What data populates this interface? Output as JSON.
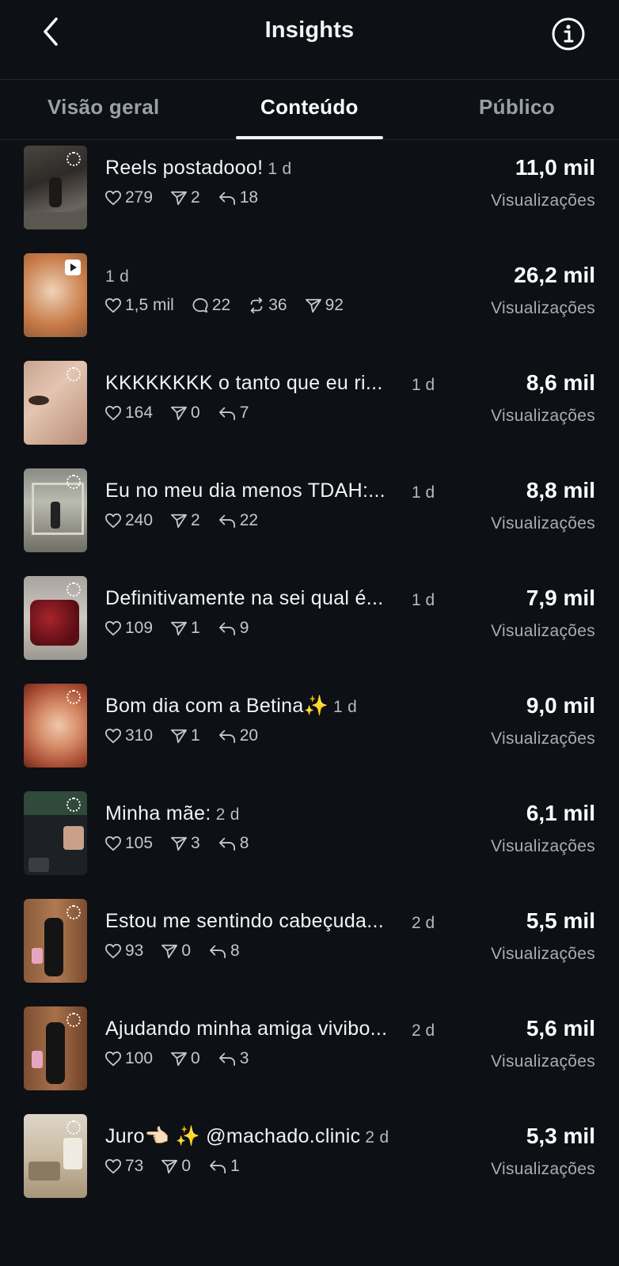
{
  "header": {
    "title": "Insights"
  },
  "tabs": [
    {
      "label": "Visão geral"
    },
    {
      "label": "Conteúdo"
    },
    {
      "label": "Público"
    }
  ],
  "views_label": "Visualizações",
  "posts": [
    {
      "caption": "Reels postadooo!",
      "age": "1 d",
      "likes": "279",
      "shares": "2",
      "replies": "18",
      "views": "11,0 mil"
    },
    {
      "caption": "",
      "age": "1 d",
      "likes": "1,5 mil",
      "comments": "22",
      "reposts": "36",
      "shares": "92",
      "views": "26,2 mil"
    },
    {
      "caption": "KKKKKKKK o tanto que eu ri...",
      "age": "1 d",
      "likes": "164",
      "shares": "0",
      "replies": "7",
      "views": "8,6 mil"
    },
    {
      "caption": "Eu no meu dia menos TDAH:...",
      "age": "1 d",
      "likes": "240",
      "shares": "2",
      "replies": "22",
      "views": "8,8 mil"
    },
    {
      "caption": "Definitivamente na sei qual é...",
      "age": "1 d",
      "likes": "109",
      "shares": "1",
      "replies": "9",
      "views": "7,9 mil"
    },
    {
      "caption": "Bom dia com a Betina✨",
      "age": "1 d",
      "likes": "310",
      "shares": "1",
      "replies": "20",
      "views": "9,0 mil"
    },
    {
      "caption": "Minha mãe:",
      "age": "2 d",
      "likes": "105",
      "shares": "3",
      "replies": "8",
      "views": "6,1 mil"
    },
    {
      "caption": "Estou me sentindo cabeçuda...",
      "age": "2 d",
      "likes": "93",
      "shares": "0",
      "replies": "8",
      "views": "5,5 mil"
    },
    {
      "caption": "Ajudando minha amiga vivibo...",
      "age": "2 d",
      "likes": "100",
      "shares": "0",
      "replies": "3",
      "views": "5,6 mil"
    },
    {
      "caption": "Juro👈🏻 ✨ @machado.clinic",
      "age": "2 d",
      "likes": "73",
      "shares": "0",
      "replies": "1",
      "views": "5,3 mil"
    }
  ]
}
